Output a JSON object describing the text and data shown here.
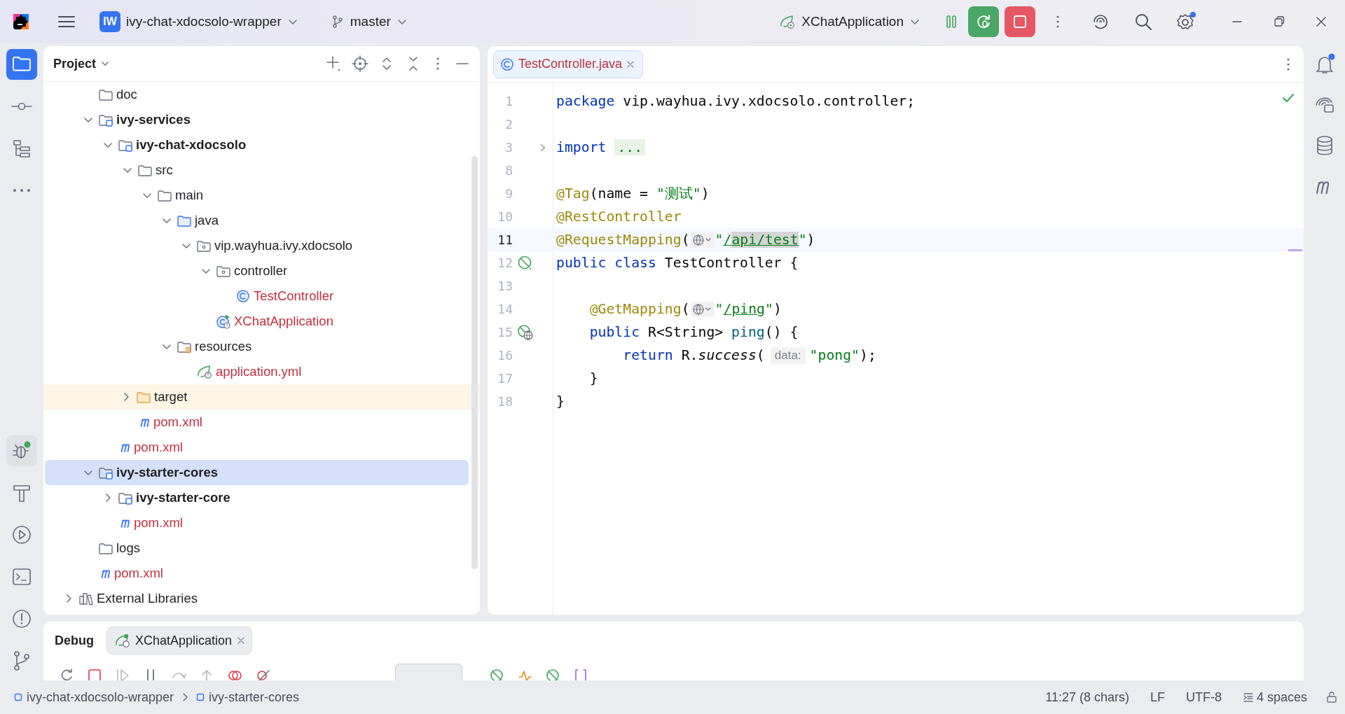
{
  "title_bar": {
    "project_badge": "IW",
    "project": "ivy-chat-xdocsolo-wrapper",
    "branch": "master",
    "run_config": "XChatApplication"
  },
  "tool_strip": {
    "top": [
      {
        "kind": "project",
        "selected": true
      },
      {
        "kind": "commit",
        "selected": false
      },
      {
        "kind": "structure",
        "selected": false
      },
      {
        "kind": "more",
        "selected": false
      }
    ],
    "bottom": [
      {
        "kind": "debug",
        "selected": true
      },
      {
        "kind": "build",
        "selected": false
      },
      {
        "kind": "run",
        "selected": false
      },
      {
        "kind": "terminal",
        "selected": false
      },
      {
        "kind": "problems",
        "selected": false
      },
      {
        "kind": "git",
        "selected": false
      }
    ]
  },
  "project_panel": {
    "title": "Project",
    "tree": [
      {
        "kind": "scrolled-root",
        "children": [
          {
            "label": "doc",
            "kind": "folder",
            "selected": false,
            "modified": false
          },
          {
            "label": "ivy-services",
            "kind": "module",
            "expanded": true,
            "selected": false,
            "modified": false,
            "children": [
              {
                "label": "ivy-chat-xdocsolo",
                "kind": "module",
                "expanded": true,
                "selected": false,
                "modified": false,
                "children": [
                  {
                    "label": "src",
                    "kind": "folder",
                    "expanded": true,
                    "selected": false,
                    "modified": false,
                    "children": [
                      {
                        "label": "main",
                        "kind": "folder",
                        "expanded": true,
                        "selected": false,
                        "modified": false,
                        "children": [
                          {
                            "label": "java",
                            "kind": "source",
                            "expanded": true,
                            "selected": false,
                            "modified": false,
                            "children": [
                              {
                                "label": "vip.wayhua.ivy.xdocsolo",
                                "kind": "package",
                                "expanded": true,
                                "selected": false,
                                "modified": false,
                                "children": [
                                  {
                                    "label": "controller",
                                    "kind": "package",
                                    "expanded": true,
                                    "selected": false,
                                    "modified": false,
                                    "children": [
                                      {
                                        "label": "TestController",
                                        "kind": "class",
                                        "selected": false,
                                        "modified": true
                                      }
                                    ]
                                  },
                                  {
                                    "label": "XChatApplication",
                                    "kind": "app",
                                    "selected": false,
                                    "modified": true
                                  }
                                ]
                              }
                            ]
                          },
                          {
                            "label": "resources",
                            "kind": "resources",
                            "expanded": true,
                            "selected": false,
                            "modified": false,
                            "children": [
                              {
                                "label": "application.yml",
                                "kind": "yaml",
                                "selected": false,
                                "modified": true
                              }
                            ]
                          }
                        ]
                      }
                    ]
                  },
                  {
                    "label": "target",
                    "kind": "excluded",
                    "expanded": false,
                    "selected": false,
                    "modified": false
                  },
                  {
                    "label": "pom.xml",
                    "kind": "maven",
                    "selected": false,
                    "modified": true
                  }
                ]
              },
              {
                "label": "pom.xml",
                "kind": "maven",
                "selected": false,
                "modified": true
              }
            ]
          },
          {
            "label": "ivy-starter-cores",
            "kind": "module",
            "expanded": true,
            "selected": true,
            "modified": false,
            "children": [
              {
                "label": "ivy-starter-core",
                "kind": "module",
                "expanded": false,
                "selected": false,
                "modified": false
              },
              {
                "label": "pom.xml",
                "kind": "maven",
                "selected": false,
                "modified": true
              }
            ]
          },
          {
            "label": "logs",
            "kind": "folder",
            "selected": false,
            "modified": false
          },
          {
            "label": "pom.xml",
            "kind": "maven",
            "selected": false,
            "modified": true
          }
        ]
      },
      {
        "label": "External Libraries",
        "kind": "libraries",
        "expanded": false,
        "selected": false,
        "modified": false
      }
    ]
  },
  "editor": {
    "tabs": [
      {
        "label": "TestController.java",
        "selected": true
      }
    ],
    "lines": [
      {
        "number": "1",
        "current": false,
        "fold": false,
        "tokens": [
          {
            "text": "package ",
            "kind": "keyword"
          },
          {
            "text": "vip.wayhua.ivy.xdocsolo.controller;",
            "kind": "plain"
          }
        ]
      },
      {
        "number": "2",
        "current": false,
        "fold": false
      },
      {
        "number": "3",
        "current": false,
        "fold": true,
        "tokens": [
          {
            "text": "import ",
            "kind": "keyword"
          },
          {
            "text": "...",
            "kind": "folded"
          }
        ]
      },
      {
        "number": "8",
        "current": false,
        "fold": false
      },
      {
        "number": "9",
        "current": false,
        "fold": false,
        "tokens": [
          {
            "text": "@Tag",
            "kind": "annotation"
          },
          {
            "text": "(name = ",
            "kind": "plain"
          },
          {
            "text": "\"测试\"",
            "kind": "string"
          },
          {
            "text": ")",
            "kind": "plain"
          }
        ]
      },
      {
        "number": "10",
        "current": false,
        "fold": false,
        "tokens": [
          {
            "text": "@RestController",
            "kind": "annotation"
          }
        ]
      },
      {
        "number": "11",
        "current": true,
        "fold": false,
        "tokens": [
          {
            "text": "@RequestMapping",
            "kind": "annotation"
          },
          {
            "text": "(",
            "kind": "plain"
          },
          {
            "kind": "globe"
          },
          {
            "text": "\"",
            "kind": "string"
          },
          {
            "text": "/",
            "kind": "url"
          },
          {
            "text": "api/test",
            "kind": "url-selected"
          },
          {
            "text": "\"",
            "kind": "string"
          },
          {
            "text": ")",
            "kind": "plain"
          }
        ]
      },
      {
        "number": "12",
        "current": false,
        "fold": false,
        "gutter_icon": {
          "kind": "bean"
        },
        "tokens": [
          {
            "text": "public class ",
            "kind": "keyword"
          },
          {
            "text": "TestController {",
            "kind": "plain"
          }
        ]
      },
      {
        "number": "13",
        "current": false,
        "fold": false
      },
      {
        "number": "14",
        "current": false,
        "fold": false,
        "tokens": [
          {
            "text": "    @GetMapping",
            "kind": "annotation"
          },
          {
            "text": "(",
            "kind": "plain"
          },
          {
            "kind": "globe"
          },
          {
            "text": "\"",
            "kind": "string"
          },
          {
            "text": "/ping",
            "kind": "url"
          },
          {
            "text": "\"",
            "kind": "string"
          },
          {
            "text": ")",
            "kind": "plain"
          }
        ]
      },
      {
        "number": "15",
        "current": false,
        "fold": false,
        "gutter_icon": {
          "kind": "endpoint"
        },
        "tokens": [
          {
            "text": "    public ",
            "kind": "keyword"
          },
          {
            "text": "R<String> ",
            "kind": "plain"
          },
          {
            "text": "ping",
            "kind": "method"
          },
          {
            "text": "() {",
            "kind": "plain"
          }
        ]
      },
      {
        "number": "16",
        "current": false,
        "fold": false,
        "tokens": [
          {
            "text": "        return ",
            "kind": "keyword"
          },
          {
            "text": "R.",
            "kind": "plain"
          },
          {
            "text": "success",
            "kind": "italic"
          },
          {
            "text": "(",
            "kind": "plain"
          },
          {
            "text": "data:",
            "kind": "hint"
          },
          {
            "text": "\"pong\"",
            "kind": "string"
          },
          {
            "text": ");",
            "kind": "plain"
          }
        ]
      },
      {
        "number": "17",
        "current": false,
        "fold": false,
        "tokens": [
          {
            "text": "    }",
            "kind": "plain"
          }
        ]
      },
      {
        "number": "18",
        "current": false,
        "fold": false,
        "tokens": [
          {
            "text": "}",
            "kind": "plain"
          }
        ]
      }
    ]
  },
  "right_strip": [
    {
      "kind": "notifications",
      "badge": true
    },
    {
      "kind": "ai-chat",
      "badge": false
    },
    {
      "kind": "database",
      "badge": false
    },
    {
      "kind": "maven",
      "badge": false
    }
  ],
  "debug_panel": {
    "title": "Debug",
    "tabs": [
      {
        "label": "XChatApplication",
        "selected": true
      }
    ]
  },
  "status_bar": {
    "breadcrumbs": [
      "ivy-chat-xdocsolo-wrapper",
      "ivy-starter-cores"
    ],
    "position": "11:27 (8 chars)",
    "line_separator": "LF",
    "encoding": "UTF-8",
    "indent": "4 spaces"
  }
}
